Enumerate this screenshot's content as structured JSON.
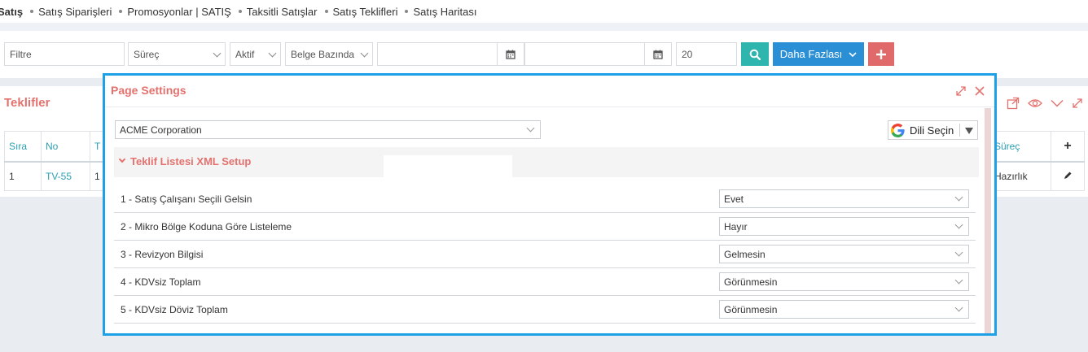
{
  "topnav": {
    "items": [
      "Satış",
      "Satış Siparişleri",
      "Promosyonlar | SATIŞ",
      "Taksitli Satışlar",
      "Satış Teklifleri",
      "Satış Haritası"
    ]
  },
  "filters": {
    "filter_placeholder": "Filtre",
    "process": "Süreç",
    "active": "Aktif",
    "basis": "Belge Bazında",
    "count": "20",
    "search_icon": "search-icon",
    "more_label": "Daha Fazlası",
    "add_icon": "plus-icon",
    "accent_teal": "#2eb5ae",
    "accent_blue": "#2b8fd6",
    "accent_red": "#e06a6a"
  },
  "panel": {
    "title": "Teklifler",
    "columns": [
      "Sıra",
      "No",
      "T",
      "Süreç",
      "+"
    ],
    "row": {
      "sira": "1",
      "no": "TV-55",
      "t": "1",
      "surec": "Hazırlık"
    }
  },
  "modal": {
    "title": "Page Settings",
    "company": "ACME Corporation",
    "translate_label": "Dili Seçin",
    "section_title": "Teklif Listesi XML Setup",
    "settings": [
      {
        "label": "1 - Satış Çalışanı Seçili Gelsin",
        "value": "Evet"
      },
      {
        "label": "2 - Mikro Bölge Koduna Göre Listeleme",
        "value": "Hayır"
      },
      {
        "label": "3 - Revizyon Bilgisi",
        "value": "Gelmesin"
      },
      {
        "label": "4 - KDVsiz Toplam",
        "value": "Görünmesin"
      },
      {
        "label": "5 - KDVsiz Döviz Toplam",
        "value": "Görünmesin"
      }
    ],
    "border_color": "#1da0e6",
    "title_color": "#e3726e"
  }
}
